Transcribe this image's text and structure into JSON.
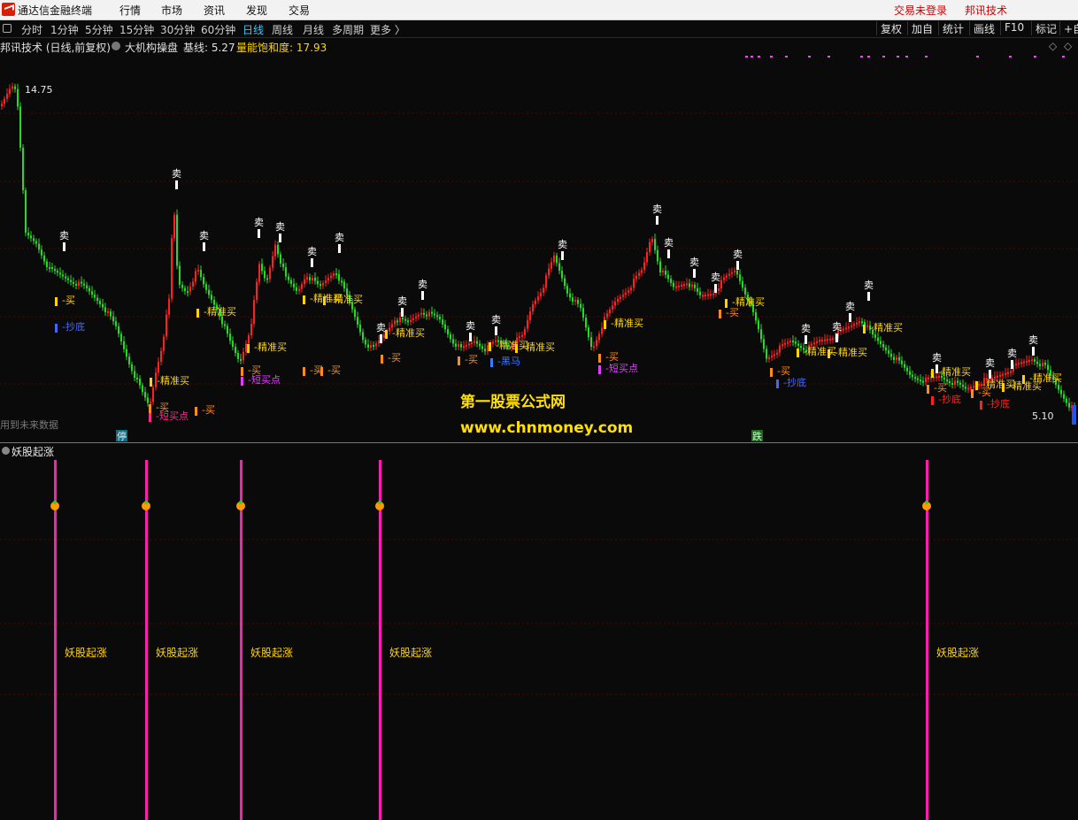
{
  "window": {
    "app_title": "通达信金融终端",
    "menu": [
      "行情",
      "市场",
      "资讯",
      "发现",
      "交易"
    ],
    "login_status": "交易未登录",
    "brand_link": "邦讯技术"
  },
  "toolbar": {
    "periods": [
      "分时",
      "1分钟",
      "5分钟",
      "15分钟",
      "30分钟",
      "60分钟",
      "日线",
      "周线",
      "月线",
      "多周期",
      "更多 〉"
    ],
    "active_period": "日线",
    "right_buttons": [
      "复权",
      "加自",
      "统计",
      "画线",
      "F10",
      "标记",
      "+自"
    ]
  },
  "main_panel": {
    "title": "邦讯技术 (日线,前复权)",
    "indicator_name": "大机构操盘",
    "baseline_label": "基线: 5.27",
    "saturation_label": "量能饱和度: 17.93",
    "high_label": "14.75",
    "low_label": "5.10",
    "future_data_note": "用到未来数据",
    "badge_stop": "停",
    "badge_fall": "跌",
    "colors": {
      "up": "#ff2020",
      "down": "#22dd22",
      "grid": "#5a0000",
      "label": "#ffd400"
    }
  },
  "sub_panel": {
    "title": "妖股起涨",
    "signal_label": "妖股起涨",
    "signal_color": "#ff1eb4"
  },
  "watermark": {
    "line1": "第一股票公式网",
    "line2": "www.chnmoney.com"
  },
  "chart_data": {
    "type": "candlestick",
    "signal_texts": [
      "卖",
      "买",
      "精准买",
      "短买点",
      "抄底",
      "黑马"
    ],
    "price_range": [
      5.1,
      14.75
    ],
    "sell_signal_count": 24,
    "subchart_signal_count": 5
  }
}
